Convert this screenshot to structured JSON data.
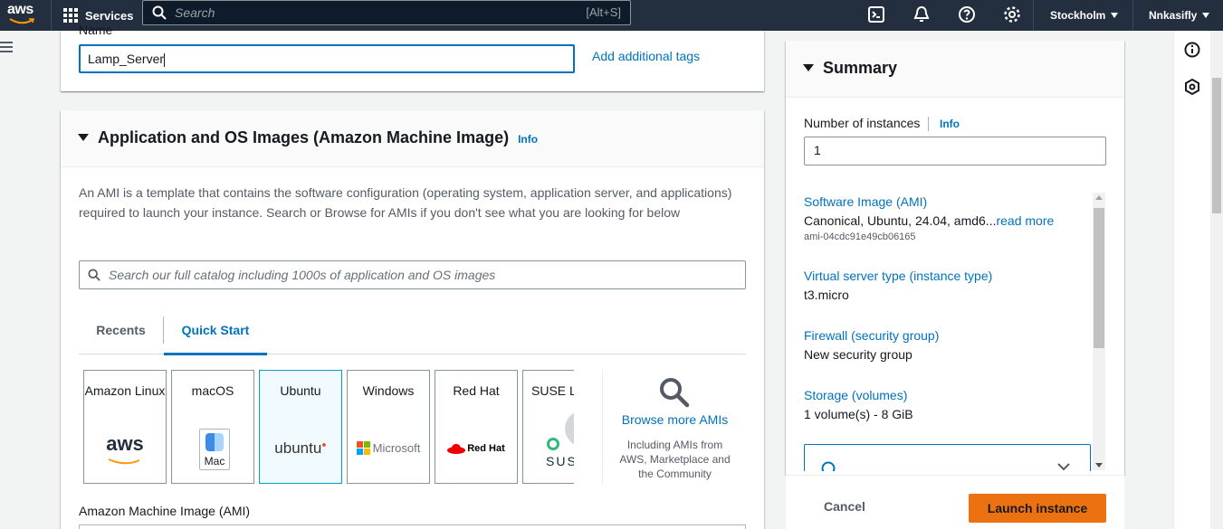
{
  "topnav": {
    "logo_text": "aws",
    "services_label": "Services",
    "search_placeholder": "Search",
    "search_shortcut": "[Alt+S]",
    "region": "Stockholm",
    "account": "Nnkasifly",
    "icons": [
      "cloudshell-icon",
      "notifications-icon",
      "help-icon",
      "settings-icon"
    ]
  },
  "name_section": {
    "label": "Name",
    "value": "Lamp_Server",
    "add_tags_link": "Add additional tags"
  },
  "ami_section": {
    "title": "Application and OS Images (Amazon Machine Image)",
    "info": "Info",
    "description": "An AMI is a template that contains the software configuration (operating system, application server, and applications) required to launch your instance. Search or Browse for AMIs if you don't see what you are looking for below",
    "search_placeholder": "Search our full catalog including 1000s of application and OS images",
    "tabs": [
      {
        "label": "Recents",
        "active": false
      },
      {
        "label": "Quick Start",
        "active": true
      }
    ],
    "os_tiles": [
      {
        "name": "Amazon Linux",
        "logo": "aws",
        "selected": false
      },
      {
        "name": "macOS",
        "logo": "Mac",
        "selected": false
      },
      {
        "name": "Ubuntu",
        "logo": "ubuntu",
        "selected": true
      },
      {
        "name": "Windows",
        "logo": "Microsoft",
        "selected": false
      },
      {
        "name": "Red Hat",
        "logo": "Red Hat",
        "selected": false
      },
      {
        "name": "SUSE Li",
        "logo": "SUS",
        "selected": false
      }
    ],
    "browse_link": "Browse more AMIs",
    "browse_sub": "Including AMIs from AWS, Marketplace and the Community",
    "ami_field_label": "Amazon Machine Image (AMI)"
  },
  "summary": {
    "title": "Summary",
    "instances_label": "Number of instances",
    "instances_info": "Info",
    "instances_value": "1",
    "items": [
      {
        "link": "Software Image (AMI)",
        "value": "Canonical, Ubuntu, 24.04, amd6...",
        "more": "read more",
        "sub": "ami-04cdc91e49cb06165"
      },
      {
        "link": "Virtual server type (instance type)",
        "value": "t3.micro"
      },
      {
        "link": "Firewall (security group)",
        "value": "New security group"
      },
      {
        "link": "Storage (volumes)",
        "value": "1 volume(s) - 8 GiB"
      }
    ],
    "cancel_label": "Cancel",
    "launch_label": "Launch instance"
  },
  "colors": {
    "nav_bg": "#232f3e",
    "link": "#0073bb",
    "primary_button": "#ec7211"
  }
}
